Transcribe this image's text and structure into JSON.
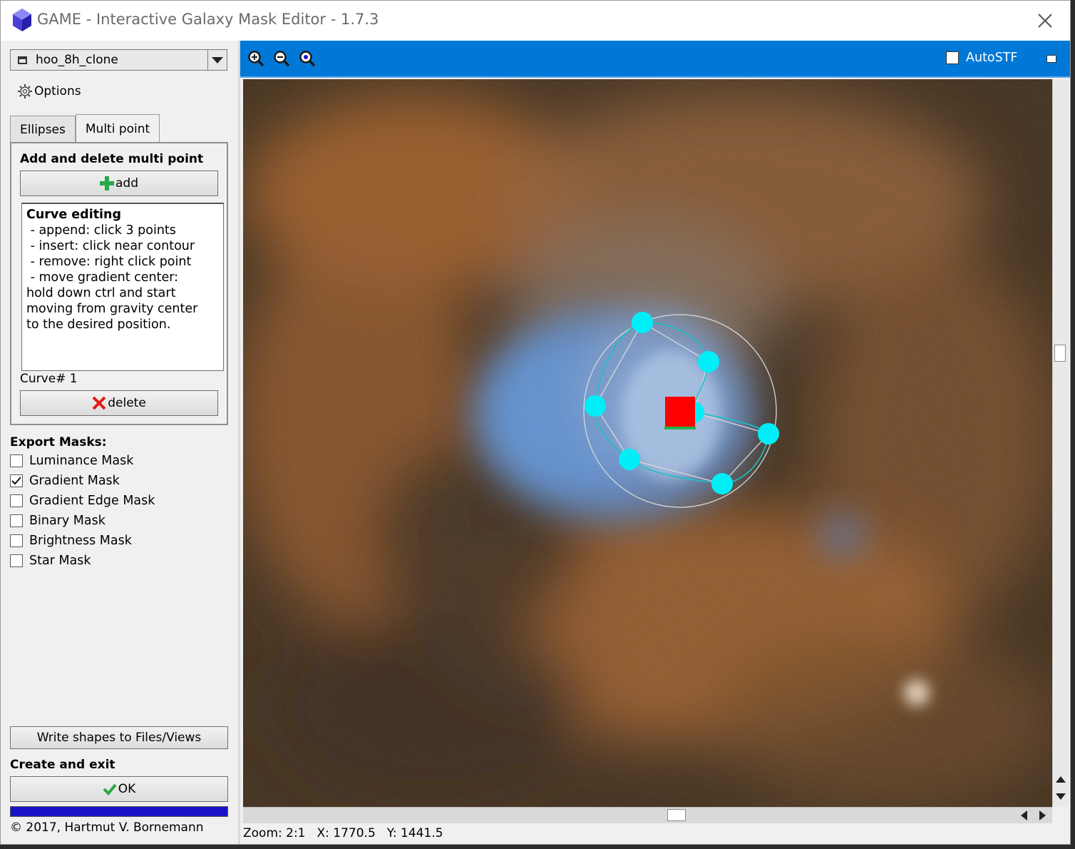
{
  "window": {
    "title": "GAME - Interactive Galaxy Mask Editor -  1.7.3"
  },
  "view_select": {
    "value": "hoo_8h_clone"
  },
  "options": {
    "label": "Options"
  },
  "tabs": [
    {
      "label": "Ellipses"
    },
    {
      "label": "Multi point"
    }
  ],
  "multipoint": {
    "section_title": "Add and delete multi point",
    "add_label": "add",
    "help_title": "Curve editing",
    "help_lines": [
      " - append: click 3 points",
      " - insert: click near contour",
      " - remove: right click point",
      " - move gradient center:",
      "hold down ctrl and start",
      "moving from gravity center",
      "to the desired position."
    ],
    "curve_label": "Curve# 1",
    "delete_label": "delete"
  },
  "export": {
    "title": "Export Masks:",
    "masks": [
      {
        "label": "Luminance Mask",
        "checked": false
      },
      {
        "label": "Gradient Mask",
        "checked": true
      },
      {
        "label": "Gradient Edge Mask",
        "checked": false
      },
      {
        "label": "Binary Mask",
        "checked": false
      },
      {
        "label": "Brightness Mask",
        "checked": false
      },
      {
        "label": "Star Mask",
        "checked": false
      }
    ]
  },
  "write_label": "Write shapes to Files/Views",
  "create_title": "Create and exit",
  "ok_label": "OK",
  "progress": 1.0,
  "copyright": "© 2017, Hartmut V. Bornemann",
  "toolbar": {
    "autostf_label": "AutoSTF",
    "autostf_checked": false
  },
  "status": {
    "zoom": "Zoom: 2:1",
    "x": "X: 1770.5",
    "y": "Y: 1441.5"
  },
  "colors": {
    "toolbar": "#0078d7",
    "handle": "#00e5f0",
    "center": "#ff0000",
    "progress": "#1a14c8"
  }
}
